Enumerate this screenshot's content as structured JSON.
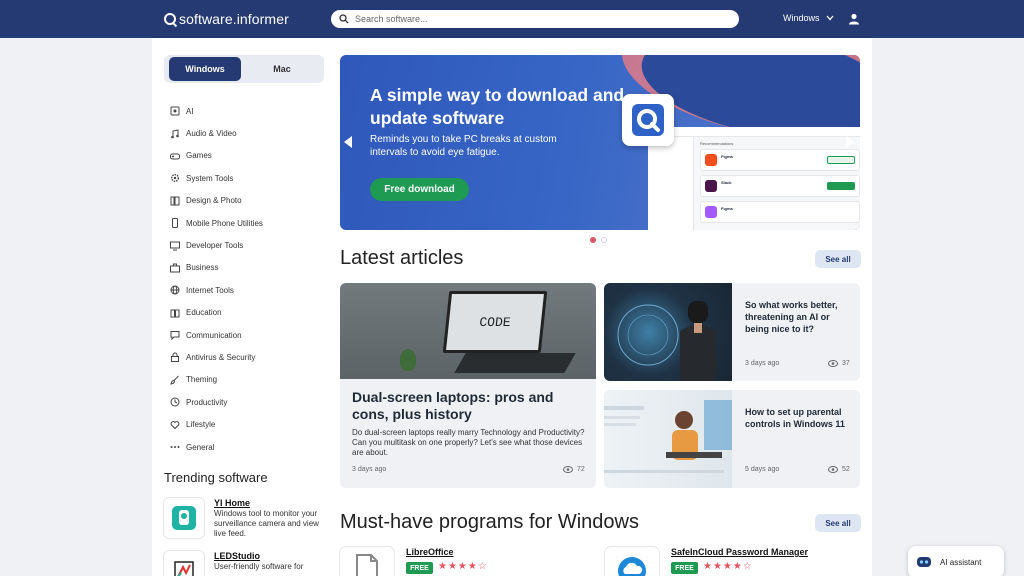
{
  "header": {
    "logo_text": "software.informer",
    "search_placeholder": "Search software...",
    "platform": "Windows"
  },
  "os_toggle": {
    "windows": "Windows",
    "mac": "Mac"
  },
  "categories": [
    {
      "label": "AI",
      "icon": "ai-icon"
    },
    {
      "label": "Audio & Video",
      "icon": "music-icon"
    },
    {
      "label": "Games",
      "icon": "gamepad-icon"
    },
    {
      "label": "System Tools",
      "icon": "gear-icon"
    },
    {
      "label": "Design & Photo",
      "icon": "palette-icon"
    },
    {
      "label": "Mobile Phone Utilities",
      "icon": "phone-icon"
    },
    {
      "label": "Developer Tools",
      "icon": "monitor-icon"
    },
    {
      "label": "Business",
      "icon": "briefcase-icon"
    },
    {
      "label": "Internet Tools",
      "icon": "globe-icon"
    },
    {
      "label": "Education",
      "icon": "book-icon"
    },
    {
      "label": "Communication",
      "icon": "chat-icon"
    },
    {
      "label": "Antivirus & Security",
      "icon": "lock-icon"
    },
    {
      "label": "Theming",
      "icon": "brush-icon"
    },
    {
      "label": "Productivity",
      "icon": "clock-icon"
    },
    {
      "label": "Lifestyle",
      "icon": "heart-icon"
    },
    {
      "label": "General",
      "icon": "dots-icon"
    }
  ],
  "trending": {
    "title": "Trending software",
    "items": [
      {
        "name": "YI Home",
        "desc": "Windows tool to monitor your surveillance camera and view live feed."
      },
      {
        "name": "LEDStudio",
        "desc": "User-friendly software for"
      }
    ]
  },
  "banner": {
    "title": "A simple way to download and update software",
    "subtitle": "Reminds you to take PC breaks at custom intervals to avoid eye fatigue.",
    "button": "Free download",
    "mock_heading": "Recommendations",
    "mock_apps": [
      "Figma",
      "Slack",
      "Figma"
    ],
    "mock_button": "Download"
  },
  "latest": {
    "title": "Latest articles",
    "see_all": "See all",
    "featured": {
      "image_text": "CODE",
      "title": "Dual-screen laptops: pros and cons, plus history",
      "desc": "Do dual-screen laptops really marry Technology and Productivity? Can you multitask on one properly? Let's see what those devices are about.",
      "date": "3 days ago",
      "views": "72"
    },
    "articles": [
      {
        "title": "So what works better, threatening an AI or being nice to it?",
        "date": "3 days ago",
        "views": "37"
      },
      {
        "title": "How to set up parental controls in Windows 11",
        "date": "5 days ago",
        "views": "52"
      }
    ]
  },
  "programs": {
    "title": "Must-have programs for Windows",
    "see_all": "See all",
    "items": [
      {
        "name": "LibreOffice",
        "badge": "FREE",
        "stars": "★★★★☆"
      },
      {
        "name": "SafeInCloud Password Manager",
        "badge": "FREE",
        "stars": "★★★★☆"
      }
    ]
  },
  "ai_assistant": {
    "label": "AI assistant"
  },
  "colors": {
    "header_bg": "#253a72",
    "accent_green": "#1f9a53",
    "star_red": "#e05561"
  }
}
